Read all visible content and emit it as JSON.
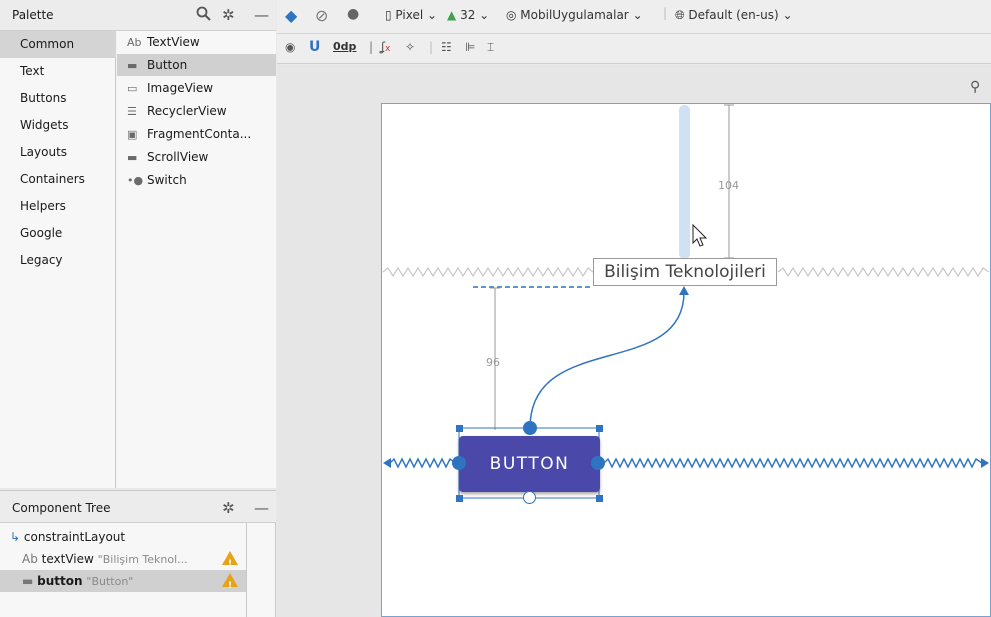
{
  "palette": {
    "title": "Palette",
    "categories": [
      "Common",
      "Text",
      "Buttons",
      "Widgets",
      "Layouts",
      "Containers",
      "Helpers",
      "Google",
      "Legacy"
    ],
    "widgets": [
      {
        "icon": "Ab",
        "label": "TextView"
      },
      {
        "icon": "▬",
        "label": "Button"
      },
      {
        "icon": "▭",
        "label": "ImageView"
      },
      {
        "icon": "☰",
        "label": "RecyclerView"
      },
      {
        "icon": "▣",
        "label": "FragmentConta..."
      },
      {
        "icon": "▬",
        "label": "ScrollView"
      },
      {
        "icon": "•●",
        "label": "Switch"
      }
    ]
  },
  "toolbar": {
    "device": "Pixel",
    "api": "32",
    "theme": "MobilUygulamalar",
    "locale": "Default (en-us)",
    "margin": "0dp"
  },
  "tree": {
    "title": "Component Tree",
    "rows": [
      {
        "icon": "↳",
        "name": "constraintLayout",
        "text": ""
      },
      {
        "icon": "Ab",
        "name": "textView",
        "text": "\"Bilişim Teknol..."
      },
      {
        "icon": "▬",
        "name": "button",
        "text": "\"Button\""
      }
    ]
  },
  "canvas": {
    "textview_text": "Bilişim Teknolojileri",
    "button_text": "BUTTON",
    "top_margin": "104",
    "button_margin": "96"
  },
  "colors": {
    "accent": "#2f74c0",
    "button": "#4a48a8",
    "warning": "#e6a31a"
  }
}
